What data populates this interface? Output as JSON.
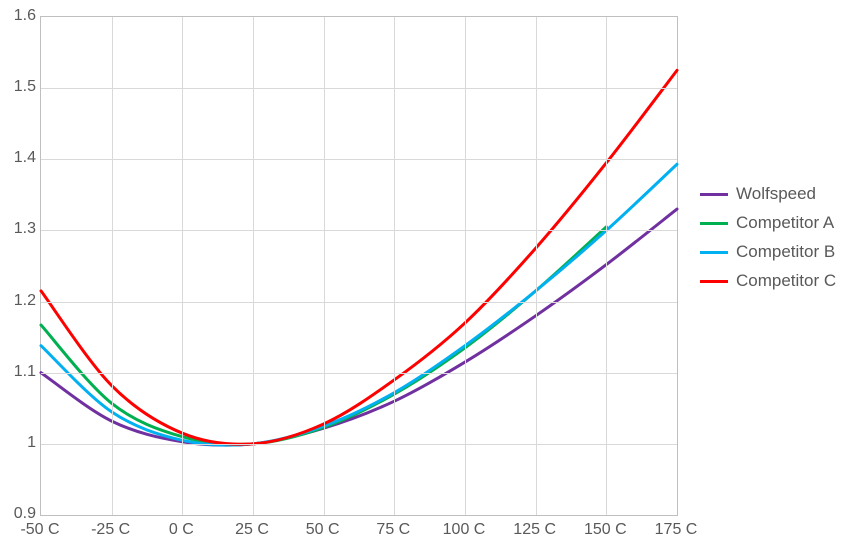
{
  "chart_data": {
    "type": "line",
    "xlabel": "",
    "ylabel": "",
    "xlim": [
      -50,
      175
    ],
    "ylim": [
      0.9,
      1.6
    ],
    "x_ticks": [
      "-50 C",
      "-25 C",
      "0 C",
      "25 C",
      "50 C",
      "75 C",
      "100 C",
      "125 C",
      "150 C",
      "175 C"
    ],
    "y_ticks": [
      "0.9",
      "1",
      "1.1",
      "1.2",
      "1.3",
      "1.4",
      "1.5",
      "1.6"
    ],
    "x_tick_values": [
      -50,
      -25,
      0,
      25,
      50,
      75,
      100,
      125,
      150,
      175
    ],
    "y_tick_values": [
      0.9,
      1.0,
      1.1,
      1.2,
      1.3,
      1.4,
      1.5,
      1.6
    ],
    "x": [
      -50,
      -25,
      0,
      25,
      50,
      75,
      100,
      125,
      150,
      175
    ],
    "series": [
      {
        "name": "Wolfspeed",
        "color": "#7030a0",
        "values": [
          1.1,
          1.032,
          1.003,
          1.0,
          1.022,
          1.06,
          1.115,
          1.18,
          1.252,
          1.33
        ]
      },
      {
        "name": "Competitor A",
        "color": "#00b050",
        "values": [
          1.167,
          1.057,
          1.01,
          1.0,
          1.023,
          1.07,
          1.135,
          1.215,
          1.305,
          null
        ]
      },
      {
        "name": "Competitor B",
        "color": "#00b0f0",
        "values": [
          1.138,
          1.045,
          1.005,
          1.0,
          1.025,
          1.072,
          1.138,
          1.215,
          1.3,
          1.393
        ]
      },
      {
        "name": "Competitor C",
        "color": "#ff0000",
        "values": [
          1.215,
          1.082,
          1.015,
          1.0,
          1.028,
          1.09,
          1.17,
          1.275,
          1.395,
          1.525
        ]
      }
    ]
  },
  "legend": {
    "items": [
      {
        "label": "Wolfspeed",
        "color": "#7030a0"
      },
      {
        "label": "Competitor A",
        "color": "#00b050"
      },
      {
        "label": "Competitor B",
        "color": "#00b0f0"
      },
      {
        "label": "Competitor C",
        "color": "#ff0000"
      }
    ]
  }
}
